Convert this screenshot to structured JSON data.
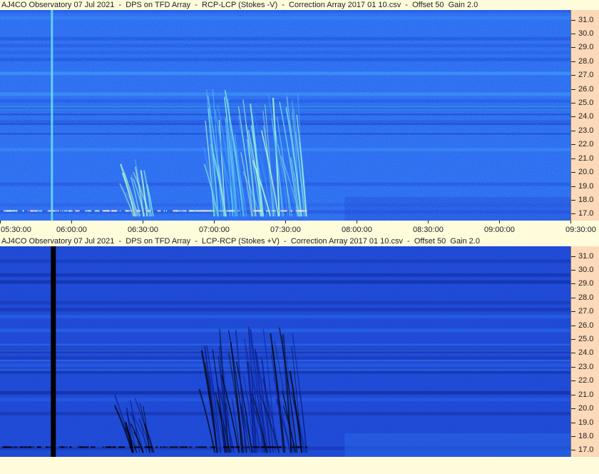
{
  "chart_data": [
    {
      "type": "heatmap",
      "title": "AJ4CO Observatory 07 Jul 2021  -  DPS on TFD Array  -  RCP-LCP (Stokes -V)  -  Correction Array 2017 01 10.csv  -  Offset 50  Gain 2.0",
      "x_ticks": [
        "05:30:00",
        "06:00:00",
        "06:30:00",
        "07:00:00",
        "07:30:00",
        "08:00:00",
        "08:30:00",
        "09:00:00",
        "09:30:00"
      ],
      "y_ticks": [
        "31.0",
        "30.0",
        "29.0",
        "28.0",
        "27.0",
        "26.0",
        "25.0",
        "24.0",
        "23.0",
        "22.0",
        "21.0",
        "20.0",
        "19.0",
        "18.0",
        "17.0"
      ],
      "xlim": [
        "05:30:00",
        "09:30:00"
      ],
      "ylim": [
        16.5,
        31.7
      ],
      "palette": [
        "#0a1a8c",
        "#1e4ad8",
        "#2a6cf0",
        "#3fa0f8",
        "#6fe0f0",
        "#b8ffd0"
      ],
      "polarity": "positive",
      "emission_events": [
        {
          "start": "07:00:00",
          "end": "07:40:00",
          "f_low": 16.8,
          "f_high": 26.0
        },
        {
          "start": "06:25:00",
          "end": "06:35:00",
          "f_low": 16.8,
          "f_high": 21.0
        }
      ],
      "vertical_artifact_time": "05:52:00"
    },
    {
      "type": "heatmap",
      "title": "AJ4CO Observatory 07 Jul 2021  -  DPS on TFD Array  -  LCP-RCP (Stokes +V)  -  Correction Array 2017 01 10.csv  -  Offset 50  Gain 2.0",
      "x_ticks": [],
      "y_ticks": [
        "31.0",
        "30.0",
        "29.0",
        "28.0",
        "27.0",
        "26.0",
        "25.0",
        "24.0",
        "23.0",
        "22.0",
        "21.0",
        "20.0",
        "19.0",
        "18.0",
        "17.0"
      ],
      "xlim": [
        "05:30:00",
        "09:30:00"
      ],
      "ylim": [
        16.5,
        31.7
      ],
      "palette": [
        "#000000",
        "#0a1e8c",
        "#1e4ad8",
        "#2a6cf0",
        "#3f8cf8",
        "#5aa8f8"
      ],
      "polarity": "negative",
      "emission_events": [
        {
          "start": "07:00:00",
          "end": "07:40:00",
          "f_low": 16.8,
          "f_high": 26.0
        },
        {
          "start": "06:25:00",
          "end": "06:35:00",
          "f_low": 16.8,
          "f_high": 21.0
        }
      ],
      "vertical_artifact_time": "05:52:00"
    }
  ]
}
